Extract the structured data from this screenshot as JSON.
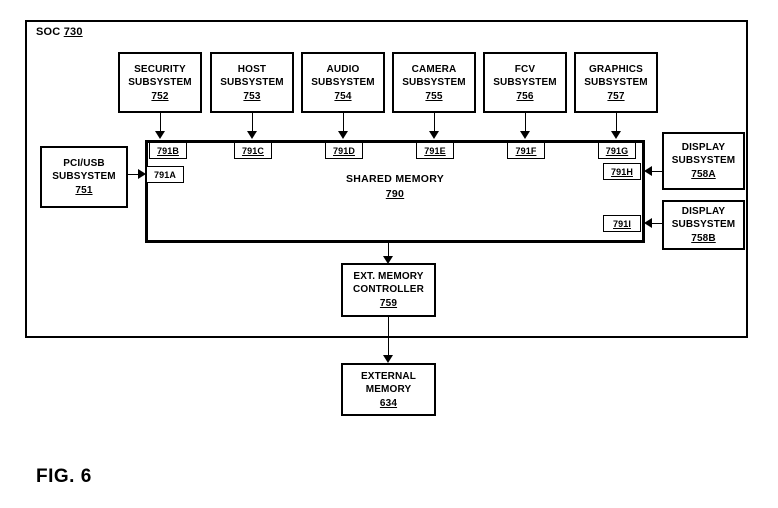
{
  "figure": {
    "caption": "FIG. 6"
  },
  "soc": {
    "label_prefix": "SOC ",
    "number": "730"
  },
  "shared_memory": {
    "title": "SHARED MEMORY",
    "number": "790"
  },
  "top_subsystems": [
    {
      "line1": "SECURITY",
      "line2": "SUBSYSTEM",
      "number": "752",
      "port": "791B"
    },
    {
      "line1": "HOST",
      "line2": "SUBSYSTEM",
      "number": "753",
      "port": "791C"
    },
    {
      "line1": "AUDIO",
      "line2": "SUBSYSTEM",
      "number": "754",
      "port": "791D"
    },
    {
      "line1": "CAMERA",
      "line2": "SUBSYSTEM",
      "number": "755",
      "port": "791E"
    },
    {
      "line1": "FCV",
      "line2": "SUBSYSTEM",
      "number": "756",
      "port": "791F"
    },
    {
      "line1": "GRAPHICS",
      "line2": "SUBSYSTEM",
      "number": "757",
      "port": "791G"
    }
  ],
  "left_subsystem": {
    "line1": "PCI/USB",
    "line2": "SUBSYSTEM",
    "number": "751",
    "port": "791A"
  },
  "right_subsystems": [
    {
      "line1": "DISPLAY",
      "line2": "SUBSYSTEM",
      "number": "758A",
      "port": "791H"
    },
    {
      "line1": "DISPLAY",
      "line2": "SUBSYSTEM",
      "number": "758B",
      "port": "791I"
    }
  ],
  "memory_controller": {
    "line1": "EXT. MEMORY",
    "line2": "CONTROLLER",
    "number": "759"
  },
  "external_memory": {
    "line1": "EXTERNAL",
    "line2": "MEMORY",
    "number": "634"
  },
  "colors": {
    "stroke": "#000000",
    "background": "#ffffff"
  }
}
